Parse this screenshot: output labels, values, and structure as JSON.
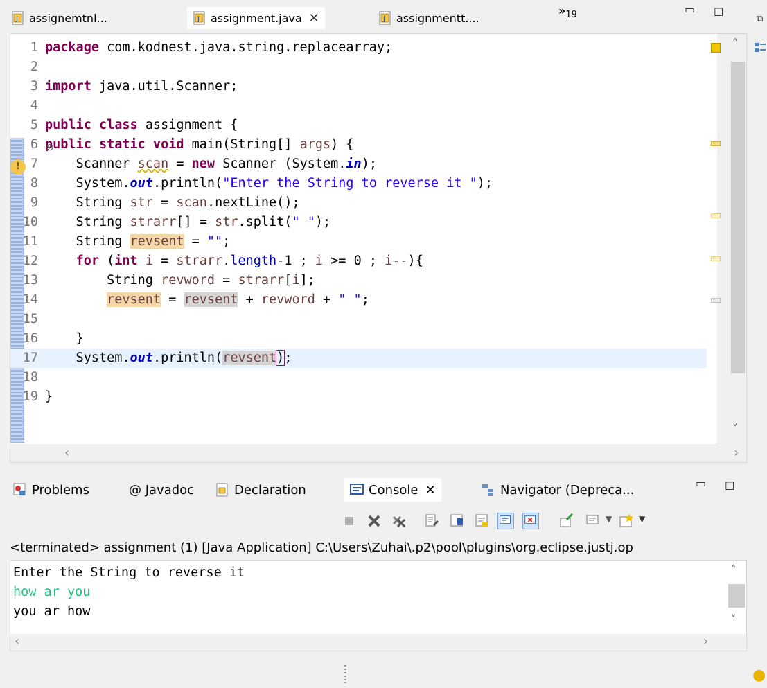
{
  "editor_tabs": [
    {
      "label": "assignemtnl...",
      "active": false
    },
    {
      "label": "assignment.java",
      "active": true
    },
    {
      "label": "assignmentt....",
      "active": false
    }
  ],
  "tab_overflow": {
    "symbol": "»",
    "count": "19"
  },
  "code_lines": [
    {
      "n": "1"
    },
    {
      "n": "2"
    },
    {
      "n": "3"
    },
    {
      "n": "4"
    },
    {
      "n": "5"
    },
    {
      "n": "6"
    },
    {
      "n": "7"
    },
    {
      "n": "8"
    },
    {
      "n": "9"
    },
    {
      "n": "10"
    },
    {
      "n": "11"
    },
    {
      "n": "12"
    },
    {
      "n": "13"
    },
    {
      "n": "14"
    },
    {
      "n": "15"
    },
    {
      "n": "16"
    },
    {
      "n": "17"
    },
    {
      "n": "18"
    },
    {
      "n": "19"
    }
  ],
  "code": {
    "l1_kw": "package",
    "l1_rest": " com.kodnest.java.string.replacearray;",
    "l3_kw": "import",
    "l3_rest": " java.util.Scanner;",
    "l5_kw": "public class",
    "l5_rest": " assignment {",
    "l6_kw": "public static void",
    "l6_a": " main(String[] ",
    "l6_var": "args",
    "l6_b": ") {",
    "l7_a": "    Scanner ",
    "l7_var": "scan",
    "l7_b": " = ",
    "l7_kw": "new",
    "l7_c": " Scanner (System.",
    "l7_fld": "in",
    "l7_d": ");",
    "l8_a": "    System.",
    "l8_fld": "out",
    "l8_b": ".println(",
    "l8_str": "\"Enter the String to reverse it \"",
    "l8_c": ");",
    "l9_a": "    String ",
    "l9_var": "str",
    "l9_b": " = ",
    "l9_var2": "scan",
    "l9_c": ".nextLine();",
    "l10_a": "    String ",
    "l10_var": "strarr",
    "l10_b": "[] = ",
    "l10_var2": "str",
    "l10_c": ".split(",
    "l10_str": "\" \"",
    "l10_d": ");",
    "l11_a": "    String ",
    "l11_var": "revsent",
    "l11_b": " = ",
    "l11_str": "\"\"",
    "l11_c": ";",
    "l12_a": "    ",
    "l12_kw": "for",
    "l12_b": " (",
    "l12_kw2": "int",
    "l12_c": " ",
    "l12_var": "i",
    "l12_d": " = ",
    "l12_var2": "strarr",
    "l12_e": ".",
    "l12_fld": "length",
    "l12_f": "-1 ; ",
    "l12_var3": "i",
    "l12_g": " >= 0 ; ",
    "l12_var4": "i",
    "l12_h": "--){",
    "l13_a": "        String ",
    "l13_var": "revword",
    "l13_b": " = ",
    "l13_var2": "strarr",
    "l13_c": "[",
    "l13_var3": "i",
    "l13_d": "];",
    "l14_a": "        ",
    "l14_var": "revsent",
    "l14_b": " = ",
    "l14_var2": "revsent",
    "l14_c": " + ",
    "l14_var3": "revword",
    "l14_d": " + ",
    "l14_str": "\" \"",
    "l14_e": ";",
    "l16": "    }",
    "l17_a": "    System.",
    "l17_fld": "out",
    "l17_b": ".println(",
    "l17_var": "revsent",
    "l17_c": ")",
    "l17_d": ";",
    "l19": "}"
  },
  "panel_tabs": [
    {
      "label": "Problems"
    },
    {
      "label": "@ Javadoc"
    },
    {
      "label": "Declaration"
    },
    {
      "label": "Console"
    },
    {
      "label": "Navigator (Depreca..."
    }
  ],
  "console_status": "<terminated> assignment (1) [Java Application] C:\\Users\\Zuhai\\.p2\\pool\\plugins\\org.eclipse.justj.op",
  "console_lines": [
    {
      "text": "Enter the String to reverse it",
      "type": "output"
    },
    {
      "text": "how ar you",
      "type": "input"
    },
    {
      "text": "you ar how",
      "type": "output"
    }
  ],
  "colors": {
    "keyword": "#7f0055",
    "string": "#2a00ff",
    "field": "#0000c0",
    "input_text": "#1fbf7a",
    "current_line": "#e8f2fe"
  }
}
